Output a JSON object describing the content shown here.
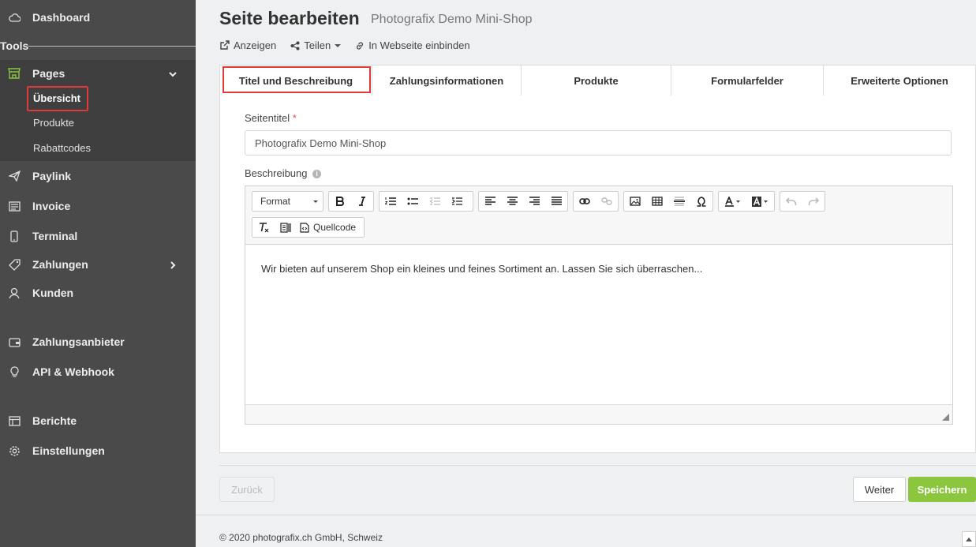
{
  "sidebar": {
    "dashboard": "Dashboard",
    "tools": "Tools",
    "pages": "Pages",
    "pages_sub": [
      "Übersicht",
      "Produkte",
      "Rabattcodes"
    ],
    "paylink": "Paylink",
    "invoice": "Invoice",
    "terminal": "Terminal",
    "zahlungen": "Zahlungen",
    "kunden": "Kunden",
    "zahlungsanbieter": "Zahlungsanbieter",
    "api": "API & Webhook",
    "berichte": "Berichte",
    "einstellungen": "Einstellungen"
  },
  "header": {
    "title": "Seite bearbeiten",
    "subtitle": "Photografix Demo Mini-Shop",
    "actions": [
      "Anzeigen",
      "Teilen",
      "In Webseite einbinden"
    ]
  },
  "tabs": [
    "Titel und Beschreibung",
    "Zahlungsinformationen",
    "Produkte",
    "Formularfelder",
    "Erweiterte Optionen"
  ],
  "form": {
    "title_label": "Seitentitel",
    "required_mark": "*",
    "title_value": "Photografix Demo Mini-Shop",
    "desc_label": "Beschreibung",
    "info_glyph": "i"
  },
  "editor": {
    "format_label": "Format",
    "source_label": "Quellcode",
    "content": "Wir bieten auf unserem Shop ein kleines und feines Sortiment an. Lassen Sie sich überraschen..."
  },
  "buttons": {
    "back": "Zurück",
    "next": "Weiter",
    "save": "Speichern"
  },
  "footer": "© 2020 photografix.ch GmbH, Schweiz",
  "colors": {
    "sidebar": "#4a4a4a",
    "accent_green": "#8cc63f",
    "highlight_red": "#e03a3a"
  }
}
